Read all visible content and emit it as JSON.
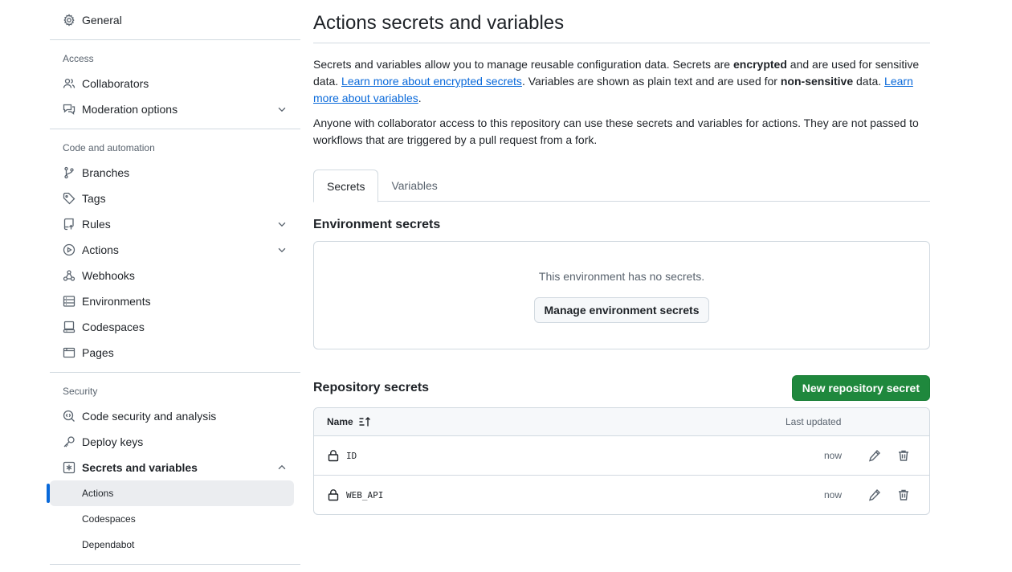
{
  "sidebar": {
    "general": "General",
    "access_heading": "Access",
    "collaborators": "Collaborators",
    "moderation": "Moderation options",
    "code_heading": "Code and automation",
    "branches": "Branches",
    "tags": "Tags",
    "rules": "Rules",
    "actions": "Actions",
    "webhooks": "Webhooks",
    "environments": "Environments",
    "codespaces": "Codespaces",
    "pages": "Pages",
    "security_heading": "Security",
    "code_security": "Code security and analysis",
    "deploy_keys": "Deploy keys",
    "secrets_vars": "Secrets and variables",
    "sub_actions": "Actions",
    "sub_codespaces": "Codespaces",
    "sub_dependabot": "Dependabot"
  },
  "main": {
    "title": "Actions secrets and variables",
    "desc1_a": "Secrets and variables allow you to manage reusable configuration data. Secrets are ",
    "desc1_b": "encrypted",
    "desc1_c": " and are used for sensitive data. ",
    "desc1_link1": "Learn more about encrypted secrets",
    "desc1_d": ". Variables are shown as plain text and are used for ",
    "desc1_e": "non-sensitive",
    "desc1_f": " data. ",
    "desc1_link2": "Learn more about variables",
    "desc1_g": ".",
    "desc2": "Anyone with collaborator access to this repository can use these secrets and variables for actions. They are not passed to workflows that are triggered by a pull request from a fork.",
    "tabs": [
      "Secrets",
      "Variables"
    ],
    "env_title": "Environment secrets",
    "env_empty": "This environment has no secrets.",
    "env_button": "Manage environment secrets",
    "repo_title": "Repository secrets",
    "new_button": "New repository secret",
    "col_name": "Name",
    "col_updated": "Last updated",
    "secrets": [
      {
        "name": "ID",
        "updated": "now"
      },
      {
        "name": "WEB_API",
        "updated": "now"
      }
    ]
  },
  "colors": {
    "accent": "#0969da",
    "primary_button": "#1f883d",
    "border": "#d1d9e0",
    "muted": "#59636e"
  }
}
